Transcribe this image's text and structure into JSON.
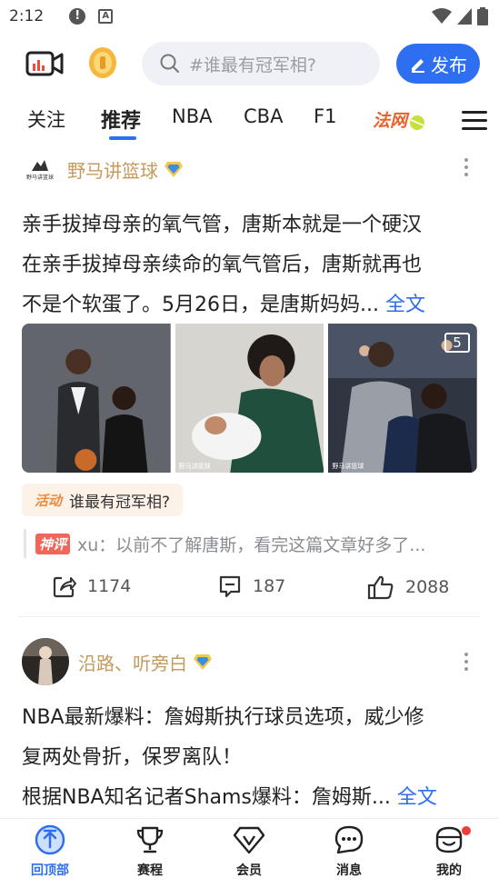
{
  "status_bar": {
    "time": "2:12",
    "icons": [
      "alert-icon",
      "a-icon",
      "wifi-icon",
      "signal-icon",
      "battery-icon"
    ]
  },
  "header": {
    "search_placeholder": "#谁最有冠军相?",
    "publish_label": "发布",
    "brand_color": "#2e6ef0"
  },
  "tabs": {
    "items": [
      {
        "label": "关注",
        "active": false
      },
      {
        "label": "推荐",
        "active": true
      },
      {
        "label": "NBA",
        "active": false
      },
      {
        "label": "CBA",
        "active": false
      },
      {
        "label": "F1",
        "active": false
      },
      {
        "label": "法网",
        "active": false
      }
    ]
  },
  "posts": [
    {
      "author": "野马讲篮球",
      "avatar_text": "野马讲篮球",
      "body_lines": [
        "亲手拔掉母亲的氧气管，唐斯本就是一个硬汉",
        "在亲手拔掉母亲续命的氧气管后，唐斯就再也",
        "不是个软蛋了。5月26日，是唐斯妈妈..."
      ],
      "full_text_link": "全文",
      "image_count": "5",
      "image_watermarks": [
        "野马讲篮球",
        "野马讲篮球"
      ],
      "activity_tag": "活动",
      "activity_text": "谁最有冠军相?",
      "hot_comment_tag": "神评",
      "hot_comment_user": "xu",
      "hot_comment_text": "xu：以前不了解唐斯，看完这篇文章好多了...",
      "shares": "1174",
      "comments": "187",
      "likes": "2088"
    },
    {
      "author": "沿路、听旁白",
      "body_lines": [
        "NBA最新爆料：詹姆斯执行球员选项，威少修",
        "复两处骨折，保罗离队！",
        "根据NBA知名记者Shams爆料：詹姆斯..."
      ],
      "full_text_link": "全文"
    }
  ],
  "bottom_nav": [
    {
      "label": "回顶部",
      "icon": "back-to-top-icon",
      "active": true
    },
    {
      "label": "赛程",
      "icon": "trophy-icon",
      "active": false
    },
    {
      "label": "会员",
      "icon": "diamond-icon",
      "active": false
    },
    {
      "label": "消息",
      "icon": "message-icon",
      "active": false
    },
    {
      "label": "我的",
      "icon": "profile-icon",
      "active": false,
      "badge_dot": true
    }
  ]
}
